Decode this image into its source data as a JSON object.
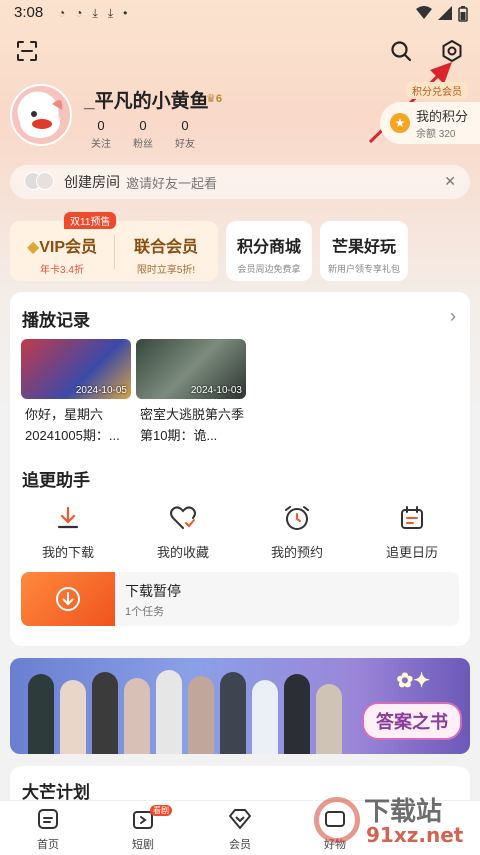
{
  "status": {
    "time": "3:08"
  },
  "profile": {
    "username": "_平凡的小黄鱼",
    "vip_level": "6",
    "stats": [
      {
        "value": "0",
        "label": "关注"
      },
      {
        "value": "0",
        "label": "粉丝"
      },
      {
        "value": "0",
        "label": "好友"
      }
    ]
  },
  "points": {
    "tag": "积分兑会员",
    "title": "我的积分",
    "balance": "余额 320"
  },
  "room": {
    "title": "创建房间",
    "subtitle": "邀请好友一起看"
  },
  "cards": {
    "promo_tag": "双11预售",
    "vip": {
      "title": "VIP会员",
      "sub": "年卡3.4折"
    },
    "joint": {
      "title": "联合会员",
      "sub": "限时立享5折!"
    },
    "shop": {
      "title": "积分商城",
      "sub": "会员周边免费拿"
    },
    "mango": {
      "title": "芒果好玩",
      "sub": "新用户领专享礼包"
    }
  },
  "history": {
    "title": "播放记录",
    "items": [
      {
        "date": "2024-10-05",
        "caption": "你好，星期六20241005期：..."
      },
      {
        "date": "2024-10-03",
        "caption": "密室大逃脱第六季 第10期：诡..."
      }
    ]
  },
  "helper": {
    "title": "追更助手",
    "items": [
      {
        "label": "我的下载",
        "icon": "download-icon"
      },
      {
        "label": "我的收藏",
        "icon": "heart-icon"
      },
      {
        "label": "我的预约",
        "icon": "alarm-clock-icon"
      },
      {
        "label": "追更日历",
        "icon": "calendar-icon"
      }
    ]
  },
  "download": {
    "title": "下载暂停",
    "sub": "1个任务"
  },
  "banner": {
    "cta": "答案之书"
  },
  "plan": {
    "title": "大芒计划"
  },
  "tabs": [
    {
      "label": "首页",
      "icon": "home-icon"
    },
    {
      "label": "短剧",
      "icon": "short-drama-icon",
      "badge": "看剧"
    },
    {
      "label": "会员",
      "icon": "vip-diamond-icon"
    },
    {
      "label": "好物",
      "icon": "shop-icon"
    }
  ],
  "watermark": {
    "text": "下载站",
    "domain": "91xz.net"
  },
  "colors": {
    "accent": "#f04a2e",
    "vip_gold": "#8a4e10",
    "arrow": "#d8262a"
  }
}
